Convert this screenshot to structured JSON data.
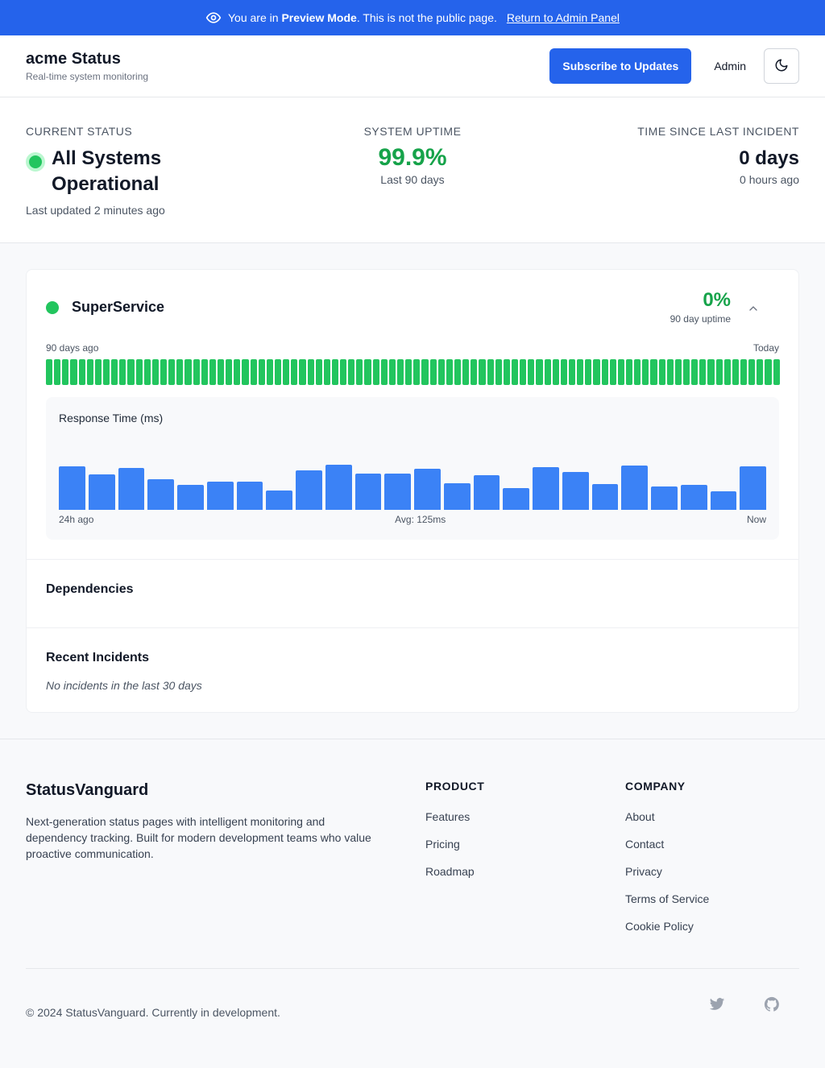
{
  "banner": {
    "prefix": "You are in ",
    "mode": "Preview Mode",
    "suffix": ". This is not the public page.",
    "link": "Return to Admin Panel"
  },
  "header": {
    "title": "acme Status",
    "subtitle": "Real-time system monitoring",
    "subscribe_label": "Subscribe to Updates",
    "admin_label": "Admin",
    "theme_icon": "moon-icon"
  },
  "summary": {
    "current_status_label": "CURRENT STATUS",
    "current_status": "All Systems Operational",
    "last_updated": "Last updated 2 minutes ago",
    "uptime_label": "SYSTEM UPTIME",
    "uptime_value": "99.9%",
    "uptime_period": "Last 90 days",
    "incident_label": "TIME SINCE LAST INCIDENT",
    "incident_days": "0 days",
    "incident_hours": "0 hours ago"
  },
  "service": {
    "name": "SuperService",
    "status_color": "#22c55e",
    "uptime_value": "0%",
    "uptime_label": "90 day uptime",
    "range_start": "90 days ago",
    "range_end": "Today",
    "day_count": 90,
    "day_color": "#22c55e",
    "response": {
      "title": "Response Time (ms)",
      "axis_start": "24h ago",
      "axis_mid": "Avg: 125ms",
      "axis_end": "Now",
      "bar_color": "#3b82f6",
      "values": [
        54,
        44,
        52,
        38,
        31,
        35,
        35,
        24,
        49,
        56,
        45,
        45,
        51,
        33,
        43,
        27,
        53,
        47,
        32,
        55,
        29,
        31,
        23,
        54
      ]
    },
    "dependencies_title": "Dependencies",
    "incidents_title": "Recent Incidents",
    "incidents_empty": "No incidents in the last 30 days"
  },
  "footer": {
    "brand": "StatusVanguard",
    "description": "Next-generation status pages with intelligent monitoring and dependency tracking. Built for modern development teams who value proactive communication.",
    "product_title": "PRODUCT",
    "product_links": [
      "Features",
      "Pricing",
      "Roadmap"
    ],
    "company_title": "COMPANY",
    "company_links": [
      "About",
      "Contact",
      "Privacy",
      "Terms of Service",
      "Cookie Policy"
    ],
    "copyright": "© 2024 StatusVanguard. Currently in development.",
    "social_icons": [
      "twitter-icon",
      "github-icon"
    ]
  },
  "colors": {
    "accent": "#2563eb",
    "success": "#16a34a"
  }
}
